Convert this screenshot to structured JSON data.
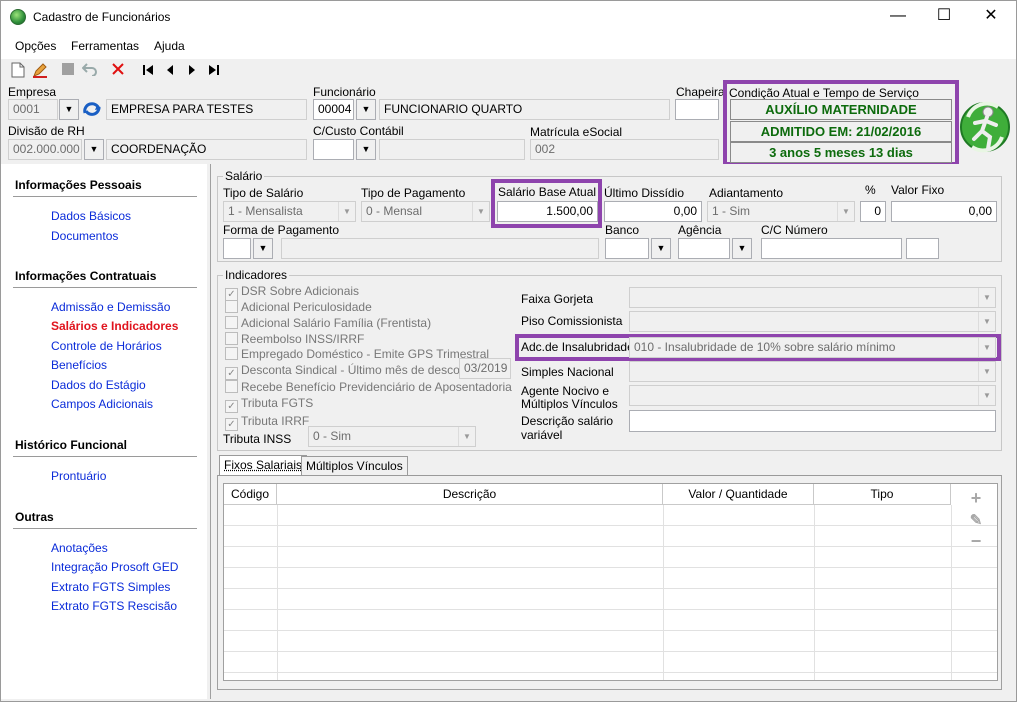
{
  "window": {
    "title": "Cadastro de Funcionários",
    "minimize": "—",
    "maximize": "☐",
    "close": "✕"
  },
  "menu": [
    "Opções",
    "Ferramentas",
    "Ajuda"
  ],
  "toolbar": {
    "icons": [
      "new-doc-icon",
      "edit-pencil-icon",
      "save-stop-icon",
      "undo-icon",
      "delete-x-icon",
      "first-record-icon",
      "prev-record-icon",
      "next-record-icon",
      "last-record-icon"
    ]
  },
  "header": {
    "empresa_label": "Empresa",
    "empresa_code": "0001",
    "empresa_name": "EMPRESA PARA TESTES",
    "funcionario_label": "Funcionário",
    "funcionario_code": "00004",
    "funcionario_name": "FUNCIONARIO QUARTO",
    "chapeira_label": "Chapeira",
    "chapeira_value": "",
    "divisao_label": "Divisão de RH",
    "divisao_code": "002.000.000",
    "divisao_name": "COORDENAÇÃO",
    "ccusto_label": "C/Custo Contábil",
    "ccusto_value": "",
    "matricula_label": "Matrícula eSocial",
    "matricula_value": "002",
    "condicao_label": "Condição Atual e Tempo de Serviço",
    "status_1": "AUXÍLIO MATERNIDADE",
    "status_2": "ADMITIDO EM: 21/02/2016",
    "status_3": "3 anos 5 meses 13 dias"
  },
  "sidebar": {
    "sections": [
      {
        "title": "Informações Pessoais",
        "items": [
          "Dados Básicos",
          "Documentos"
        ]
      },
      {
        "title": "Informações Contratuais",
        "items": [
          "Admissão e Demissão",
          "Salários e Indicadores",
          "Controle de Horários",
          "Benefícios",
          "Dados do Estágio",
          "Campos Adicionais"
        ]
      },
      {
        "title": "Histórico Funcional",
        "items": [
          "Prontuário"
        ]
      },
      {
        "title": "Outras",
        "items": [
          "Anotações",
          "Integração Prosoft GED",
          "Extrato FGTS Simples",
          "Extrato FGTS Rescisão"
        ]
      }
    ],
    "active_item": "Salários e Indicadores"
  },
  "salario": {
    "group_title": "Salário",
    "tipo_salario_label": "Tipo de Salário",
    "tipo_salario_value": "1 - Mensalista",
    "tipo_pagamento_label": "Tipo de Pagamento",
    "tipo_pagamento_value": "0 - Mensal",
    "salario_base_label": "Salário Base Atual",
    "salario_base_value": "1.500,00",
    "ultimo_dissidio_label": "Último Dissídio",
    "ultimo_dissidio_value": "0,00",
    "adiantamento_label": "Adiantamento",
    "adiantamento_value": "1 - Sim",
    "pct_label": "%",
    "pct_value": "0",
    "valor_fixo_label": "Valor Fixo",
    "valor_fixo_value": "0,00",
    "forma_pagamento_label": "Forma de Pagamento",
    "forma_pagamento_value": "",
    "banco_label": "Banco",
    "banco_value": "",
    "agencia_label": "Agência",
    "agencia_value": "",
    "cc_label": "C/C Número",
    "cc_value": ""
  },
  "indicadores": {
    "group_title": "Indicadores",
    "checks": [
      {
        "label": "DSR Sobre Adicionais",
        "checked": true
      },
      {
        "label": "Adicional Periculosidade",
        "checked": false
      },
      {
        "label": "Adicional Salário Família (Frentista)",
        "checked": false
      },
      {
        "label": "Reembolso INSS/IRRF",
        "checked": false
      },
      {
        "label": "Empregado Doméstico - Emite GPS Trimestral",
        "checked": false
      },
      {
        "label": "Desconta Sindical - Último mês de desconto",
        "checked": true
      },
      {
        "label": "Recebe Benefício Previdenciário de Aposentadoria",
        "checked": false
      },
      {
        "label": "Tributa FGTS",
        "checked": true
      },
      {
        "label": "Tributa IRRF",
        "checked": true
      }
    ],
    "sindical_mes": "03/2019",
    "tributa_inss_label": "Tributa INSS",
    "tributa_inss_value": "0 - Sim",
    "faixa_gorjeta_label": "Faixa Gorjeta",
    "piso_label": "Piso Comissionista",
    "insalubridade_label": "Adc.de Insalubridade",
    "insalubridade_value": "010 - Insalubridade de 10% sobre salário mínimo",
    "simples_label": "Simples Nacional",
    "agente_label_1": "Agente Nocivo e",
    "agente_label_2": "Múltiplos Vínculos",
    "descricao_label_1": "Descrição salário",
    "descricao_label_2": "variável"
  },
  "tabs": [
    "Fixos Salariais",
    "Múltiplos Vínculos"
  ],
  "grid": {
    "columns": [
      "Código",
      "Descrição",
      "Valor / Quantidade",
      "Tipo"
    ]
  },
  "grid_actions": {
    "add": "+",
    "edit": "✎",
    "remove": "−"
  }
}
